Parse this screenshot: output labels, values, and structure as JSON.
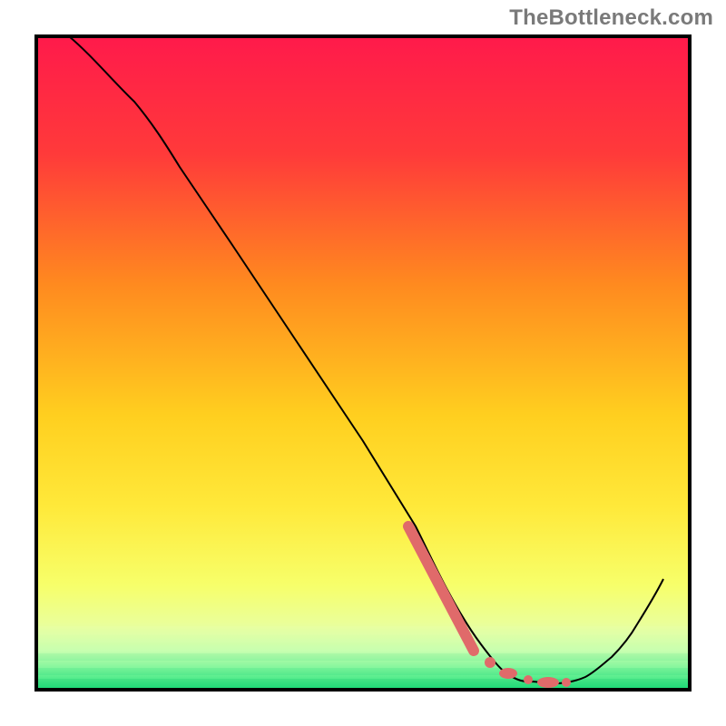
{
  "watermark": {
    "text": "TheBottleneck.com"
  },
  "chart_data": {
    "type": "line",
    "title": "",
    "xlabel": "",
    "ylabel": "",
    "x_range": [
      0,
      100
    ],
    "y_range": [
      0,
      100
    ],
    "background_gradient": {
      "top": "#ff1a4b",
      "mid_high": "#ff8a1f",
      "mid": "#ffe93a",
      "low": "#ffff99",
      "bottom": "#1fe07a"
    },
    "series": [
      {
        "name": "curve",
        "points": [
          {
            "x": 5,
            "y": 100
          },
          {
            "x": 15,
            "y": 90
          },
          {
            "x": 22,
            "y": 80
          },
          {
            "x": 30,
            "y": 68
          },
          {
            "x": 40,
            "y": 53
          },
          {
            "x": 50,
            "y": 38
          },
          {
            "x": 58,
            "y": 25
          },
          {
            "x": 63,
            "y": 15
          },
          {
            "x": 68,
            "y": 7
          },
          {
            "x": 72,
            "y": 2.5
          },
          {
            "x": 76,
            "y": 1.2
          },
          {
            "x": 80,
            "y": 1.0
          },
          {
            "x": 84,
            "y": 2.0
          },
          {
            "x": 88,
            "y": 5.0
          },
          {
            "x": 92,
            "y": 10
          },
          {
            "x": 96,
            "y": 17
          }
        ]
      },
      {
        "name": "highlight-dash",
        "points": [
          {
            "x": 57,
            "y": 25
          },
          {
            "x": 67,
            "y": 6
          },
          {
            "x": 72,
            "y": 2.5
          },
          {
            "x": 76,
            "y": 1.5
          },
          {
            "x": 80,
            "y": 1.2
          }
        ]
      }
    ]
  }
}
